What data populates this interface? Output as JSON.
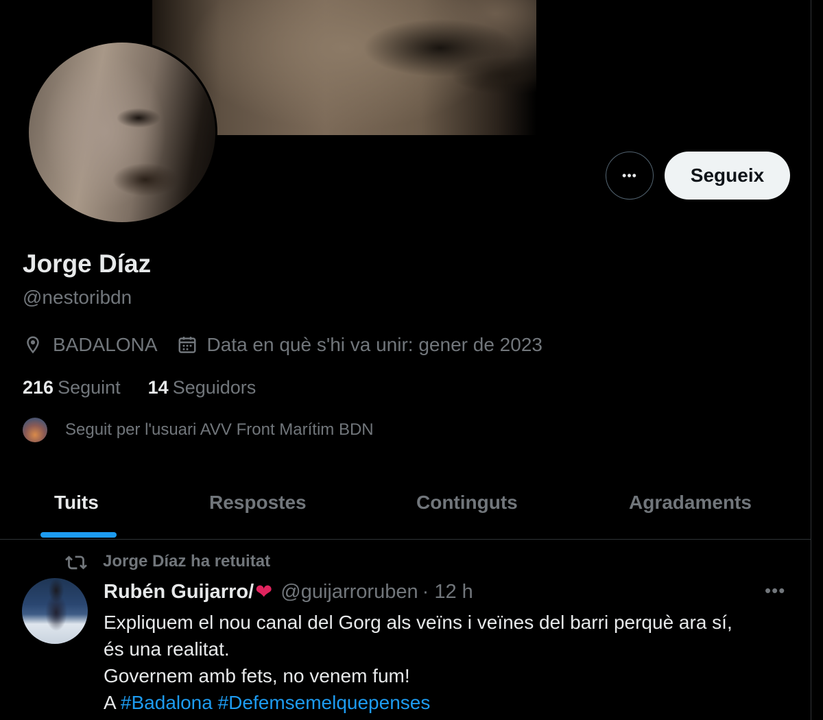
{
  "profile": {
    "name": "Jorge Díaz",
    "handle": "@nestoribdn",
    "location": "BADALONA",
    "joined": "Data en què s'hi va unir: gener de 2023",
    "following_count": "216",
    "following_label": "Seguint",
    "followers_count": "14",
    "followers_label": "Seguidors",
    "followed_by": "Seguit per l'usuari AVV Front Marítim BDN"
  },
  "actions": {
    "more_label": "•••",
    "follow_label": "Segueix"
  },
  "tabs": [
    {
      "label": "Tuits",
      "active": true
    },
    {
      "label": "Respostes",
      "active": false
    },
    {
      "label": "Continguts",
      "active": false
    },
    {
      "label": "Agradaments",
      "active": false
    }
  ],
  "tweet": {
    "retweet_label": "Jorge Díaz ha retuitat",
    "author_name": "Rubén Guijarro/",
    "author_handle": "@guijarroruben",
    "time": "· 12 h",
    "more_label": "•••",
    "lines": [
      "Expliquem el nou canal del Gorg als veïns i veïnes del barri perquè ara sí,",
      "és una realitat.",
      "Governem amb fets, no venem fum!"
    ],
    "last_prefix": "A ",
    "hashtags": [
      "#Badalona",
      "#Defemsemelquepenses"
    ]
  },
  "colors": {
    "background": "#000000",
    "accent": "#1d9bf0",
    "text_primary": "#e7e9ea",
    "text_secondary": "#71767b",
    "follow_button_bg": "#eff3f4",
    "heart": "#e0245e"
  },
  "icons": [
    "location-pin-icon",
    "calendar-icon",
    "retweet-icon",
    "more-options-icon",
    "heart-emoji-icon"
  ]
}
